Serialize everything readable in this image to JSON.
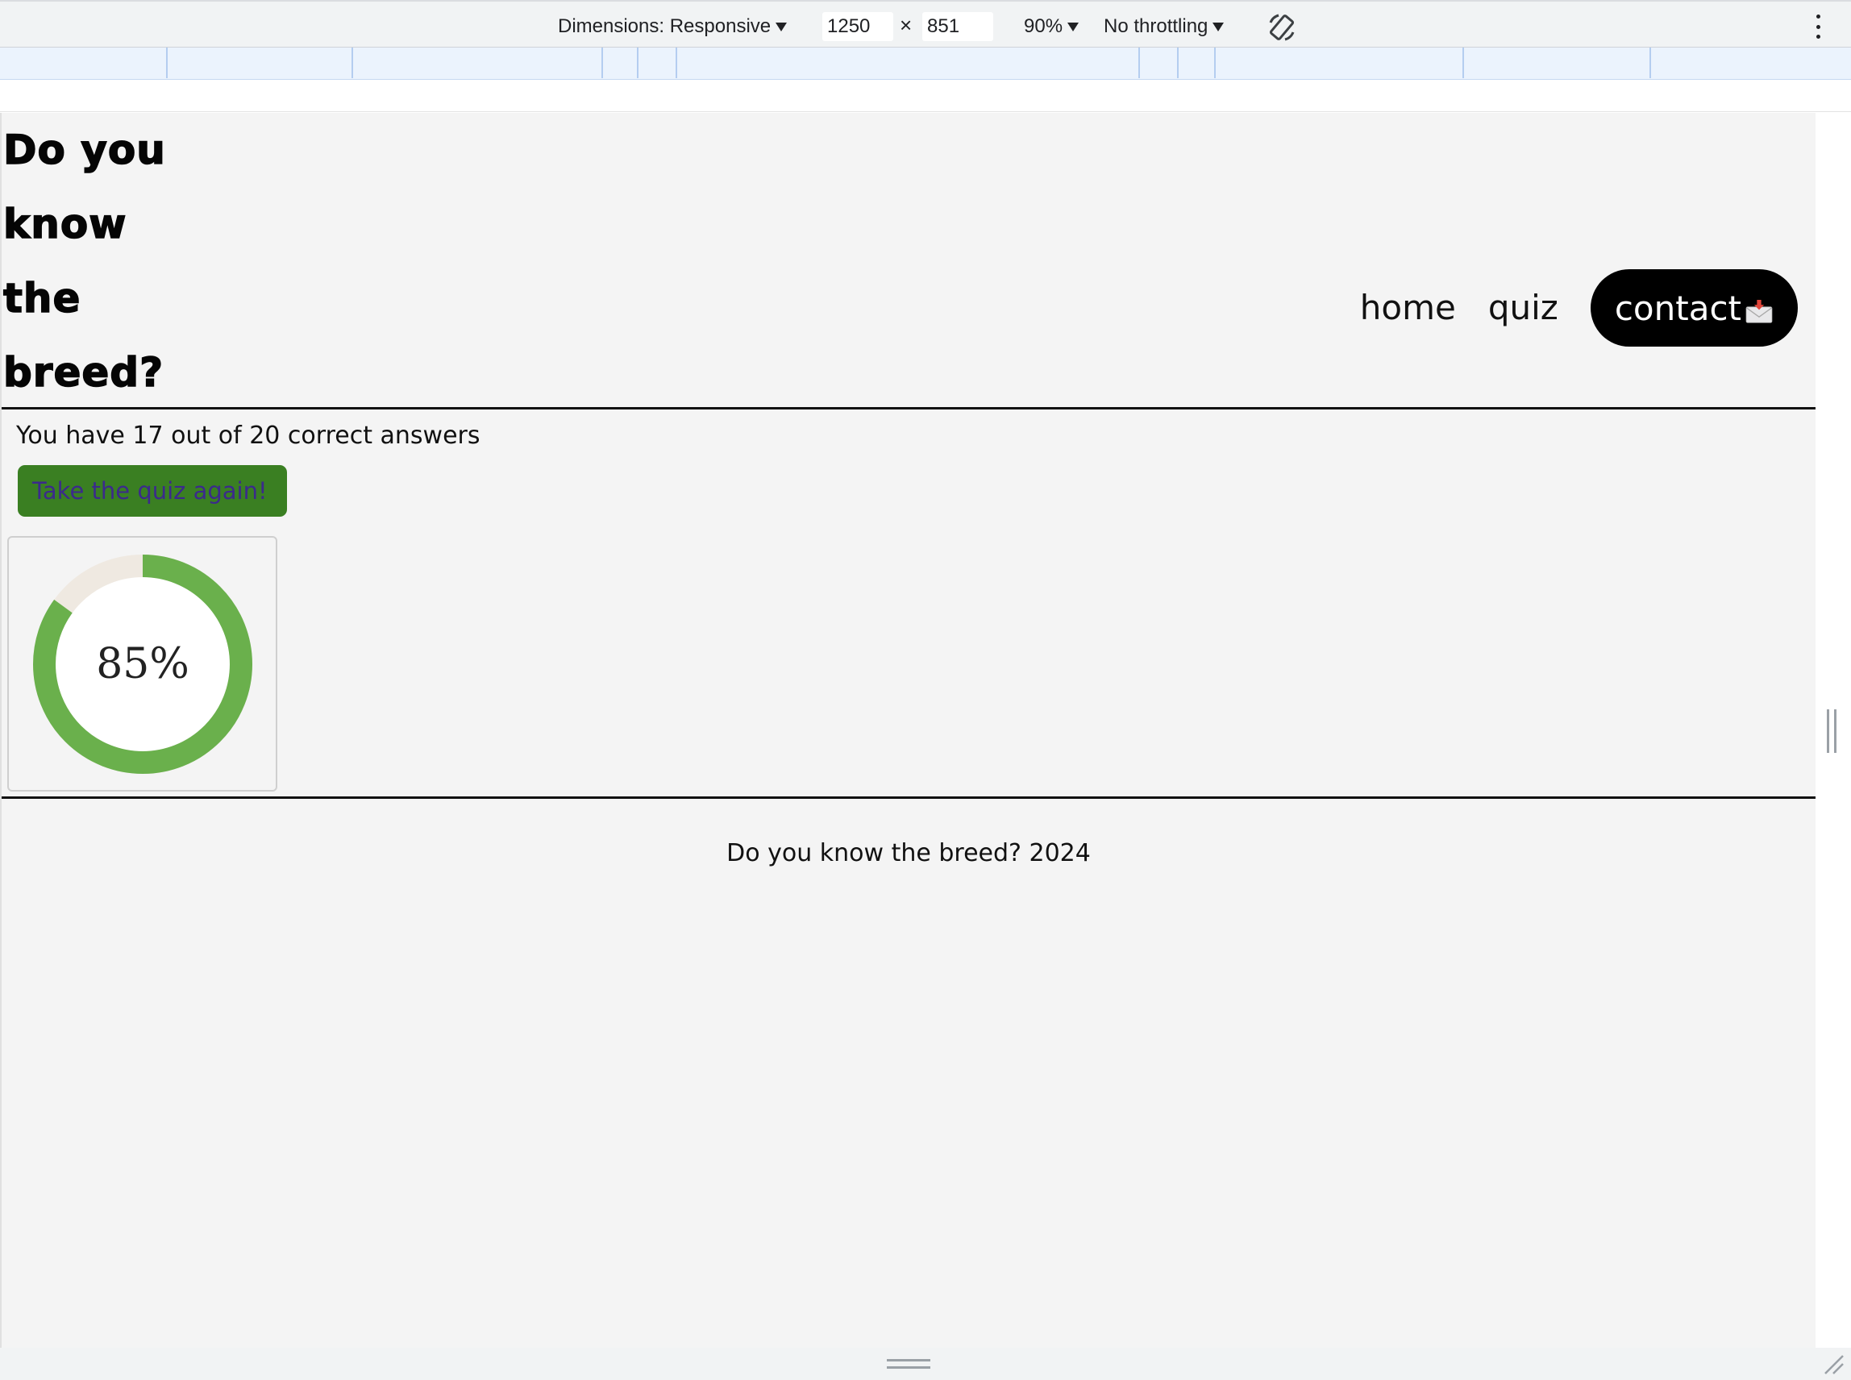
{
  "devtools": {
    "dimensions_label": "Dimensions: Responsive",
    "width_value": "1250",
    "height_value": "851",
    "times_symbol": "×",
    "zoom_label": "90%",
    "throttling_label": "No throttling",
    "icons": [
      "rotate-icon",
      "more-options-icon"
    ]
  },
  "site": {
    "title_lines": [
      "Do you",
      "know",
      "the",
      "breed?"
    ],
    "nav": {
      "home_label": "home",
      "quiz_label": "quiz",
      "contact_label": "contact"
    },
    "results": {
      "score_text": "You have 17 out of 20 correct answers",
      "retake_label": "Take the quiz again!",
      "percent_label": "85%",
      "percent_value": 85
    },
    "footer_text": "Do you know the breed? 2024"
  },
  "colors": {
    "page_background": "#f4f4f4",
    "accent_green": "#6ab04c",
    "button_green": "#3a7f22",
    "button_text": "#3b2a8c",
    "donut_track": "#efe9e1",
    "contact_background": "#000000"
  }
}
